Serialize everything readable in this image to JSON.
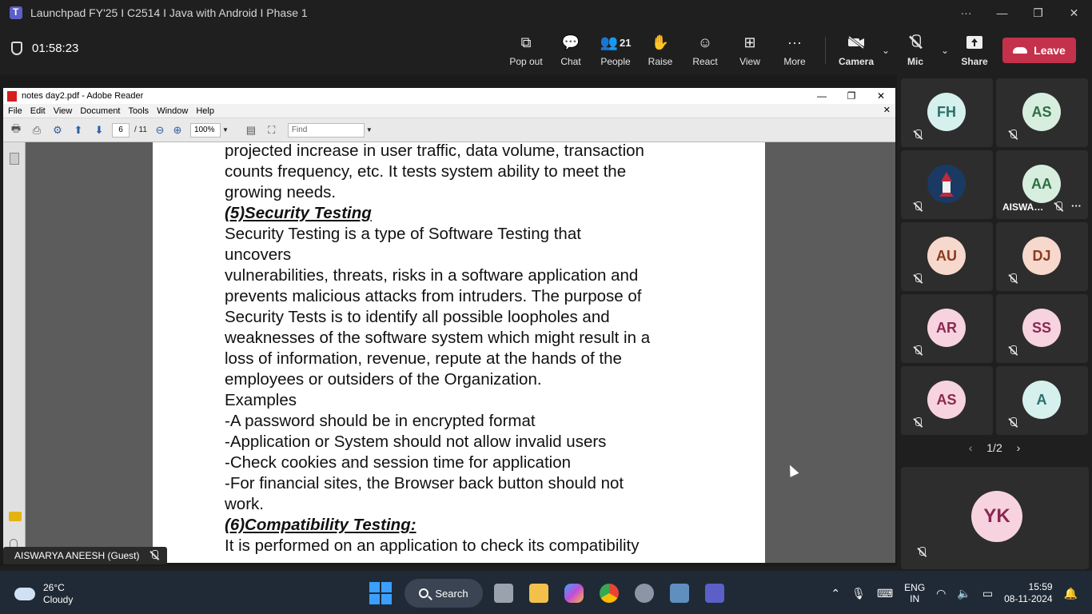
{
  "window": {
    "title": "Launchpad FY'25 I C2514 I Java with Android I Phase 1",
    "controls": [
      "···",
      "—",
      "❐",
      "✕"
    ]
  },
  "meeting": {
    "timer": "01:58:23",
    "tools": [
      {
        "name": "pop-out",
        "label": "Pop out",
        "icon": "⧉"
      },
      {
        "name": "chat",
        "label": "Chat",
        "icon": "💬"
      },
      {
        "name": "people",
        "label": "People",
        "icon": "👥",
        "count": "21"
      },
      {
        "name": "raise",
        "label": "Raise",
        "icon": "✋"
      },
      {
        "name": "react",
        "label": "React",
        "icon": "☺"
      },
      {
        "name": "view",
        "label": "View",
        "icon": "⊞"
      },
      {
        "name": "more",
        "label": "More",
        "icon": "···"
      }
    ],
    "camera_label": "Camera",
    "mic_label": "Mic",
    "share_label": "Share",
    "leave_label": "Leave",
    "leave_color": "#c4314b"
  },
  "adobe": {
    "title": "notes day2.pdf - Adobe Reader",
    "menu": [
      "File",
      "Edit",
      "View",
      "Document",
      "Tools",
      "Window",
      "Help"
    ],
    "page_current": "6",
    "page_total": "/ 11",
    "zoom": "100%",
    "find_placeholder": "Find",
    "lines": [
      {
        "text": "projected increase in user traffic, data volume, transaction",
        "heading": false
      },
      {
        "text": "counts frequency, etc. It tests system ability to meet the",
        "heading": false
      },
      {
        "text": "growing needs.",
        "heading": false
      },
      {
        "text": "(5)Security Testing",
        "heading": true
      },
      {
        "text": "Security Testing is a type of Software Testing that",
        "heading": false
      },
      {
        "text": "uncovers",
        "heading": false
      },
      {
        "text": "vulnerabilities, threats, risks in a software application and",
        "heading": false
      },
      {
        "text": "prevents malicious attacks from intruders. The purpose of",
        "heading": false
      },
      {
        "text": "Security Tests is to identify all possible loopholes and",
        "heading": false
      },
      {
        "text": "weaknesses of the software system which might result in a",
        "heading": false
      },
      {
        "text": "loss of information, revenue, repute at the hands of the",
        "heading": false
      },
      {
        "text": "employees or outsiders of the Organization.",
        "heading": false
      },
      {
        "text": "Examples",
        "heading": false
      },
      {
        "text": "-A password should be in encrypted format",
        "heading": false
      },
      {
        "text": "-Application or System should not allow invalid users",
        "heading": false
      },
      {
        "text": "-Check cookies and session time for application",
        "heading": false
      },
      {
        "text": "-For financial sites, the Browser back button should not",
        "heading": false
      },
      {
        "text": "work.",
        "heading": false
      },
      {
        "text": "(6)Compatibility Testing:",
        "heading": true
      },
      {
        "text": "It is performed on an application to check its compatibility",
        "heading": false
      }
    ]
  },
  "presenter_label": "AISWARYA ANEESH (Guest)",
  "participants": [
    {
      "initials": "FH",
      "bg": "#d6f0ee",
      "fg": "#2a6f6b",
      "name": ""
    },
    {
      "initials": "AS",
      "bg": "#d7eede",
      "fg": "#2f6d45",
      "name": ""
    },
    {
      "initials": "",
      "bg": "#1a3a63",
      "fg": "#ffffff",
      "name": "",
      "image": true
    },
    {
      "initials": "AA",
      "bg": "#d7eede",
      "fg": "#2f6d45",
      "name": "AISWA…"
    },
    {
      "initials": "AU",
      "bg": "#f6d8cc",
      "fg": "#8a3b22",
      "name": ""
    },
    {
      "initials": "DJ",
      "bg": "#f6d8cc",
      "fg": "#8a3b22",
      "name": ""
    },
    {
      "initials": "AR",
      "bg": "#f6d3df",
      "fg": "#8a2850",
      "name": ""
    },
    {
      "initials": "SS",
      "bg": "#f6d3df",
      "fg": "#8a2850",
      "name": ""
    },
    {
      "initials": "AS",
      "bg": "#f6d3df",
      "fg": "#8a2850",
      "name": ""
    },
    {
      "initials": "A",
      "bg": "#d6f0ee",
      "fg": "#2a6f6b",
      "name": ""
    }
  ],
  "pager": {
    "prev": "‹",
    "label": "1/2",
    "next": "›"
  },
  "big_participant": {
    "initials": "YK",
    "bg": "#f6d3df",
    "fg": "#8a2850"
  },
  "taskbar": {
    "temp": "26°C",
    "condition": "Cloudy",
    "search_label": "Search",
    "lang_line1": "ENG",
    "lang_line2": "IN",
    "time": "15:59",
    "date": "08-11-2024"
  }
}
